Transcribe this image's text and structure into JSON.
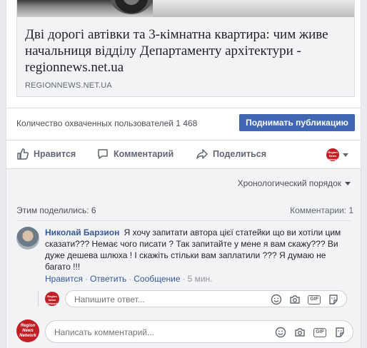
{
  "preview": {
    "title": "Дві дорогі автівки та 3-кімнатна квартира: чим живе начальниця відділу Департаменту архітектури - regionnews.net.ua",
    "domain": "REGIONNEWS.NET.UA"
  },
  "reach": {
    "text": "Количество охваченных пользователей 1 468",
    "boost_label": "Поднимать публикацию"
  },
  "actions": {
    "like": "Нравится",
    "comment": "Комментарий",
    "share": "Поделиться"
  },
  "comments": {
    "order_label": "Хронологический порядок",
    "shares_text": "Этим поделились: 6",
    "count_text": "Комментарии: 1",
    "items": [
      {
        "author": "Николай Барзион",
        "text": "Я хочу запитати автора цієї статейки що ви хотіли цим сказати??? Немає чого писати ? Так запитайте у мене я вам скажу??? Ви дуже дешева шлюха ! І скажіть стільки вам заплатили ??? Я думаю не багато !!!",
        "like_label": "Нравится",
        "reply_label": "Ответить",
        "message_label": "Сообщение",
        "time": "5 мин."
      }
    ],
    "reply_placeholder": "Напишите ответ...",
    "comment_placeholder": "Написать комментарий..."
  },
  "page_avatar_text": "Region News Network",
  "icons": {
    "like": "thumbs-up-icon",
    "comment": "speech-bubble-icon",
    "share": "share-arrow-icon",
    "emoji": "smiley-icon",
    "camera": "camera-icon",
    "gif": "gif-icon",
    "sticker": "sticker-icon"
  },
  "colors": {
    "accent": "#4267b2",
    "link": "#385898",
    "page_avatar": "#c01f26"
  }
}
